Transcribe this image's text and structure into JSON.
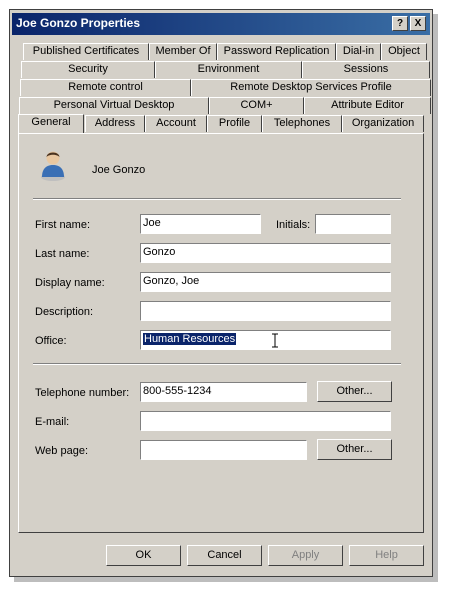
{
  "window": {
    "title": "Joe Gonzo Properties"
  },
  "title_buttons": {
    "help": "?",
    "close": "X"
  },
  "tabs": {
    "row1": [
      "Published Certificates",
      "Member Of",
      "Password Replication",
      "Dial-in",
      "Object"
    ],
    "row2": [
      "Security",
      "Environment",
      "Sessions"
    ],
    "row3": [
      "Remote control",
      "Remote Desktop Services Profile"
    ],
    "row4": [
      "Personal Virtual Desktop",
      "COM+",
      "Attribute Editor"
    ],
    "row5": [
      "General",
      "Address",
      "Account",
      "Profile",
      "Telephones",
      "Organization"
    ]
  },
  "user": {
    "name": "Joe Gonzo"
  },
  "form": {
    "first_name_label": "First name:",
    "first_name": "Joe",
    "initials_label": "Initials:",
    "initials": "",
    "last_name_label": "Last name:",
    "last_name": "Gonzo",
    "display_name_label": "Display name:",
    "display_name": "Gonzo, Joe",
    "description_label": "Description:",
    "description": "",
    "office_label": "Office:",
    "office": "Human Resources",
    "telephone_label": "Telephone number:",
    "telephone": "800-555-1234",
    "email_label": "E-mail:",
    "email": "",
    "webpage_label": "Web page:",
    "webpage": "",
    "other_button": "Other..."
  },
  "buttons": {
    "ok": "OK",
    "cancel": "Cancel",
    "apply": "Apply",
    "help": "Help"
  }
}
